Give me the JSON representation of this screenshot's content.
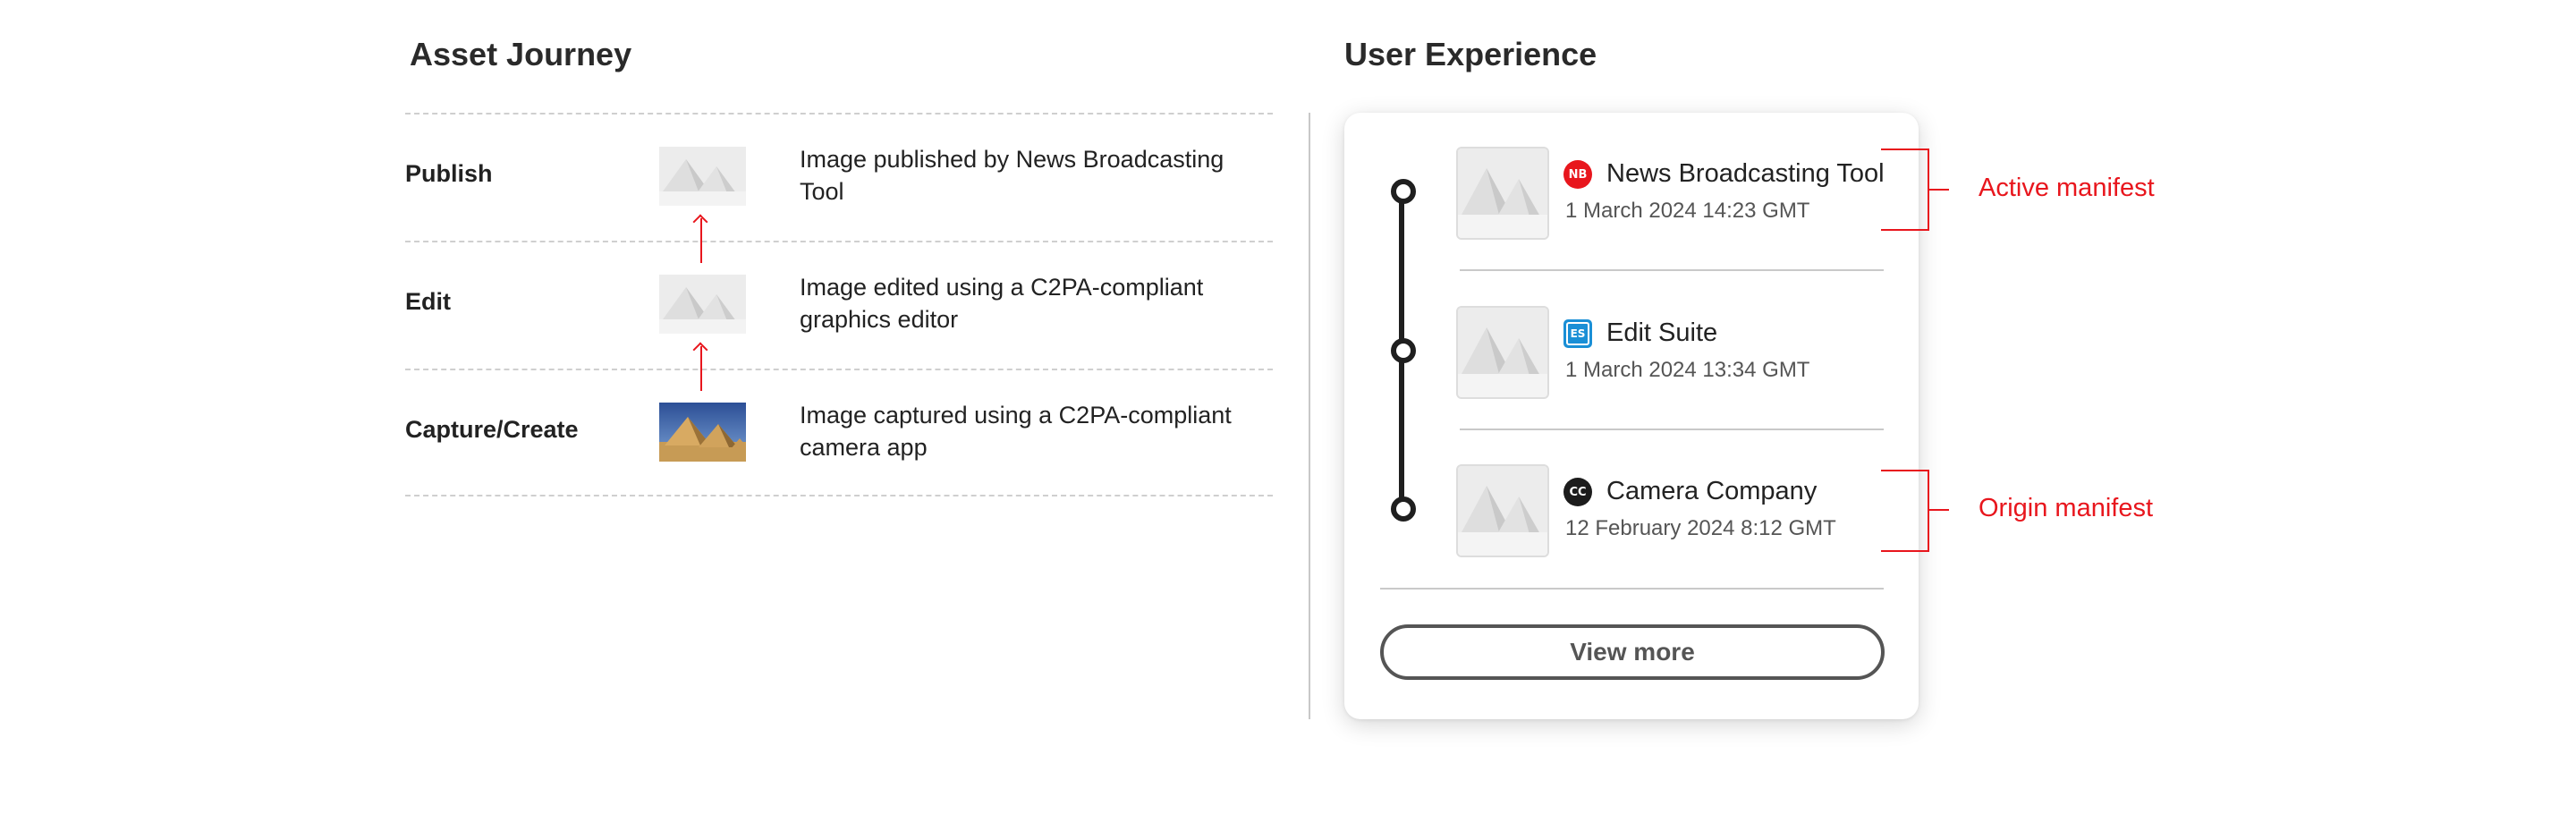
{
  "asset_journey": {
    "title": "Asset Journey",
    "steps": [
      {
        "label": "Publish",
        "description": "Image published by News Broadcasting Tool",
        "thumbnail": "snowy-pyramids-image"
      },
      {
        "label": "Edit",
        "description": "Image edited using a C2PA-compliant graphics editor",
        "thumbnail": "snowy-pyramids-image"
      },
      {
        "label": "Capture/Create",
        "description": "Image captured using a C2PA-compliant camera app",
        "thumbnail": "desert-pyramids-image"
      }
    ],
    "arrow_color": "#e8161d"
  },
  "user_experience": {
    "title": "User Experience",
    "manifests": [
      {
        "badge": "NB",
        "badge_color": "#e8161d",
        "name": "News Broadcasting Tool",
        "date": "1 March 2024 14:23 GMT"
      },
      {
        "badge": "ES",
        "badge_color": "#1a8fd6",
        "name": "Edit Suite",
        "date": "1 March 2024 13:34 GMT"
      },
      {
        "badge": "CC",
        "badge_color": "#1c1c1c",
        "name": "Camera Company",
        "date": "12 February 2024 8:12 GMT"
      }
    ],
    "view_more_label": "View more",
    "annotations": {
      "active": "Active manifest",
      "origin": "Origin manifest",
      "color": "#e8161d"
    }
  }
}
